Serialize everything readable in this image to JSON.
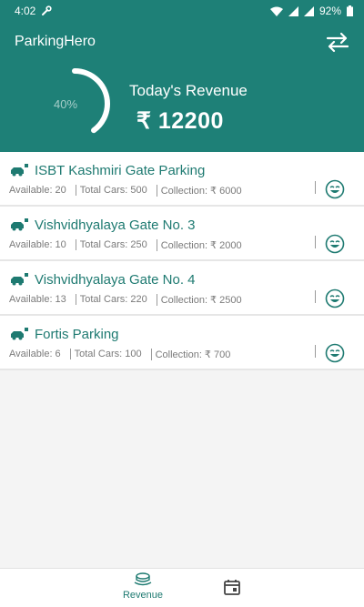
{
  "status_bar": {
    "time": "4:02",
    "battery": "92%"
  },
  "app": {
    "title": "ParkingHero"
  },
  "summary": {
    "progress_label": "40%",
    "progress_fraction": 0.4,
    "revenue_title": "Today's Revenue",
    "revenue_amount": "₹ 12200"
  },
  "parkings": [
    {
      "name": "ISBT Kashmiri Gate Parking",
      "available_label": "Available:",
      "available": "20",
      "cars_label": "Total Cars:",
      "cars": "500",
      "collection_label": "Collection:",
      "collection": "₹ 6000"
    },
    {
      "name": "Vishvidhyalaya Gate No. 3",
      "available_label": "Available:",
      "available": "10",
      "cars_label": "Total Cars:",
      "cars": "250",
      "collection_label": "Collection:",
      "collection": "₹ 2000"
    },
    {
      "name": "Vishvidhyalaya Gate No. 4",
      "available_label": "Available:",
      "available": "13",
      "cars_label": "Total Cars:",
      "cars": "220",
      "collection_label": "Collection:",
      "collection": "₹ 2500"
    },
    {
      "name": "Fortis Parking",
      "available_label": "Available:",
      "available": "6",
      "cars_label": "Total Cars:",
      "cars": "100",
      "collection_label": "Collection:",
      "collection": "₹ 700"
    }
  ],
  "bottom_nav": {
    "revenue_label": "Revenue"
  },
  "colors": {
    "primary": "#1e8077",
    "accent_text": "#1e7a71"
  },
  "icons": {
    "status": [
      "wrench-icon",
      "wifi-icon",
      "signal-icon",
      "battery-icon"
    ],
    "header": "swap-icon",
    "card": [
      "car-parking-icon",
      "smiley-icon"
    ],
    "nav": [
      "revenue-coins-icon",
      "calendar-icon"
    ]
  }
}
